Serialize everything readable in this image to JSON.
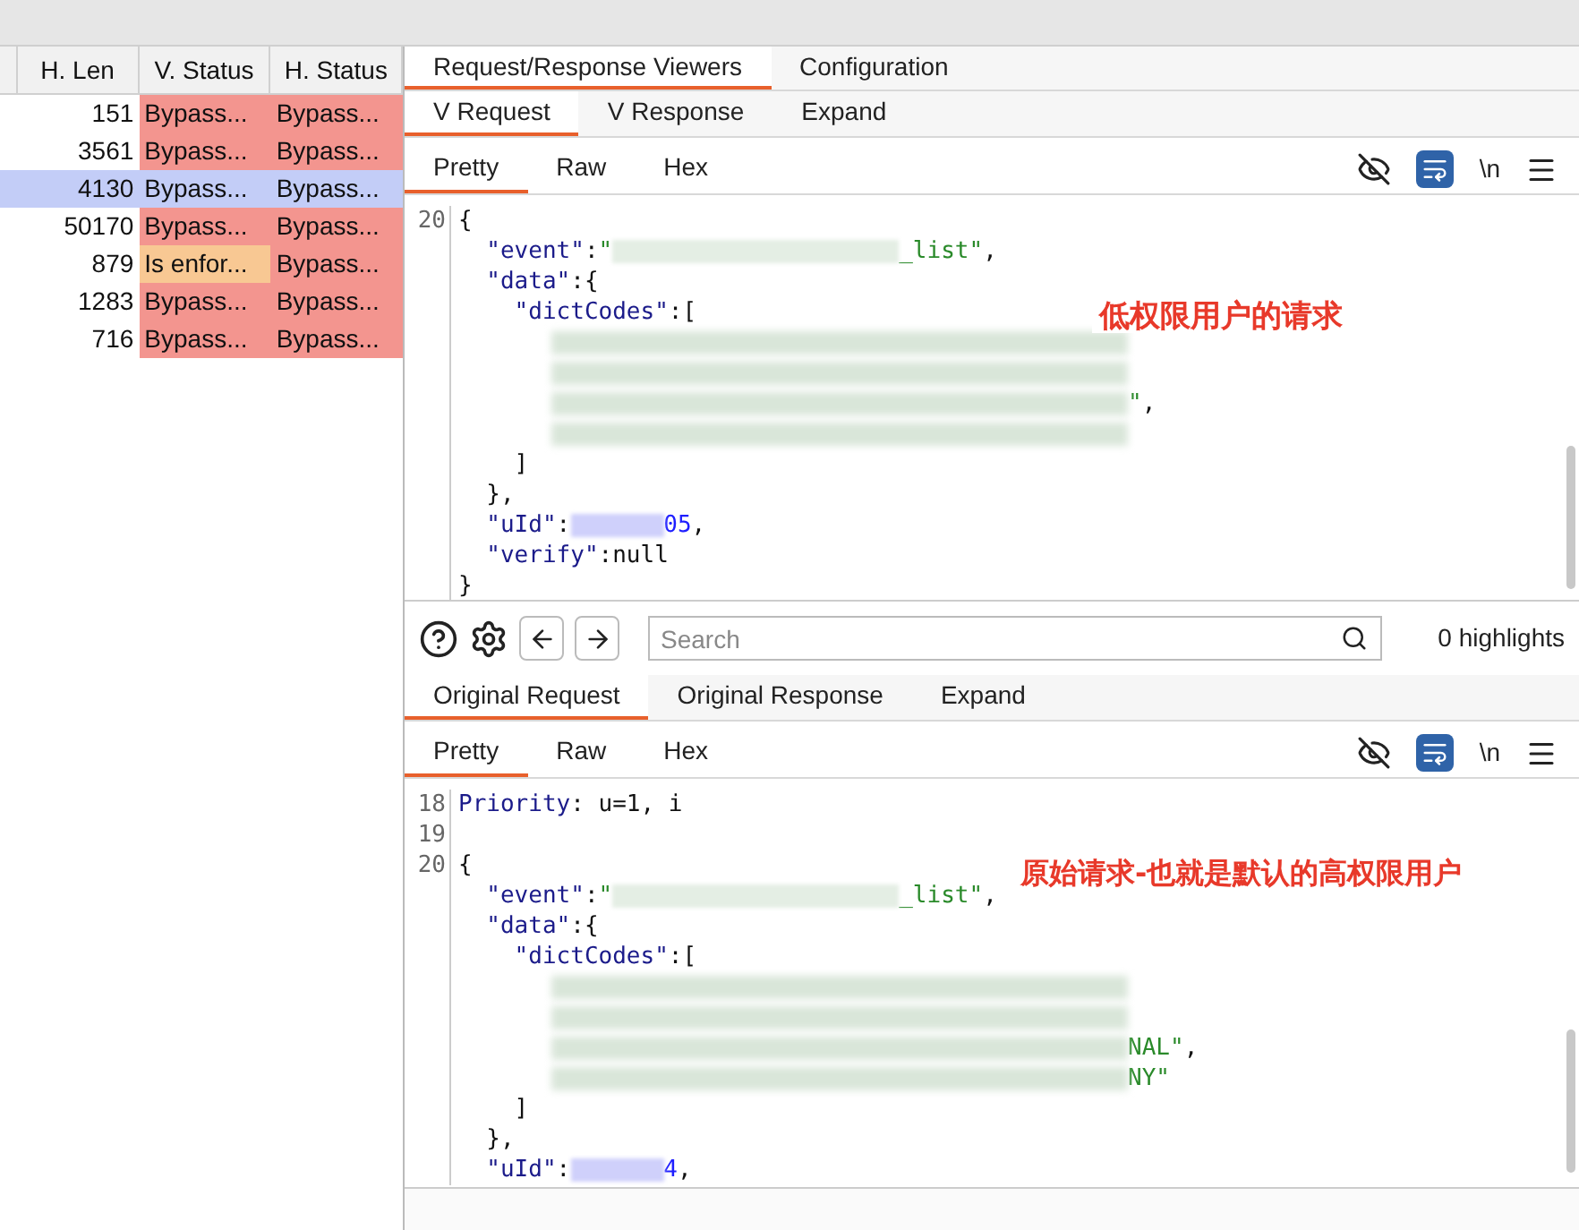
{
  "table": {
    "columns": [
      "H. Len",
      "V. Status",
      "H. Status"
    ],
    "rows": [
      {
        "h_len": "151",
        "v_status": {
          "text": "Bypass...",
          "color": "#f3958f"
        },
        "h_status": {
          "text": "Bypass...",
          "color": "#f3958f"
        },
        "selected": false
      },
      {
        "h_len": "3561",
        "v_status": {
          "text": "Bypass...",
          "color": "#f3958f"
        },
        "h_status": {
          "text": "Bypass...",
          "color": "#f3958f"
        },
        "selected": false
      },
      {
        "h_len": "4130",
        "v_status": {
          "text": "Bypass..."
        },
        "h_status": {
          "text": "Bypass..."
        },
        "selected": true
      },
      {
        "h_len": "50170",
        "v_status": {
          "text": "Bypass...",
          "color": "#f3958f"
        },
        "h_status": {
          "text": "Bypass...",
          "color": "#f3958f"
        },
        "selected": false
      },
      {
        "h_len": "879",
        "v_status": {
          "text": "Is enfor...",
          "color": "#f8c893"
        },
        "h_status": {
          "text": "Bypass...",
          "color": "#f3958f"
        },
        "selected": false
      },
      {
        "h_len": "1283",
        "v_status": {
          "text": "Bypass...",
          "color": "#f3958f"
        },
        "h_status": {
          "text": "Bypass...",
          "color": "#f3958f"
        },
        "selected": false
      },
      {
        "h_len": "716",
        "v_status": {
          "text": "Bypass...",
          "color": "#f3958f"
        },
        "h_status": {
          "text": "Bypass...",
          "color": "#f3958f"
        },
        "selected": false
      }
    ]
  },
  "top_tabs": [
    {
      "label": "Request/Response Viewers",
      "selected": true
    },
    {
      "label": "Configuration",
      "selected": false
    }
  ],
  "editors": [
    {
      "tabs": [
        {
          "label": "V Request",
          "selected": true
        },
        {
          "label": "V Response",
          "selected": false
        },
        {
          "label": "Expand",
          "selected": false
        }
      ],
      "view_tabs": [
        {
          "label": "Pretty",
          "selected": true
        },
        {
          "label": "Raw",
          "selected": false
        },
        {
          "label": "Hex",
          "selected": false
        }
      ],
      "newline_label": "\\n",
      "wrap_on": true,
      "annotation": "低权限用户的请求",
      "lines": [
        {
          "number": "20",
          "tokens": [
            {
              "kind": "punct",
              "text": "{"
            }
          ]
        },
        {
          "tokens": [
            {
              "kind": "key",
              "text": "  \"event\""
            },
            {
              "kind": "punct",
              "text": ":"
            },
            {
              "kind": "str",
              "text": "\""
            },
            {
              "kind": "blur_long"
            },
            {
              "kind": "str",
              "text": "_list\""
            },
            {
              "kind": "punct",
              "text": ","
            }
          ]
        },
        {
          "tokens": [
            {
              "kind": "key",
              "text": "  \"data\""
            },
            {
              "kind": "punct",
              "text": ":{"
            }
          ]
        },
        {
          "tokens": [
            {
              "kind": "key",
              "text": "    \"dictCodes\""
            },
            {
              "kind": "punct",
              "text": ":["
            }
          ]
        },
        {
          "tokens": [
            {
              "kind": "blur_block"
            }
          ]
        },
        {
          "tokens": [
            {
              "kind": "blur_block"
            }
          ]
        },
        {
          "tokens": [
            {
              "kind": "blur_block"
            },
            {
              "kind": "str",
              "text": "\""
            },
            {
              "kind": "punct",
              "text": ","
            }
          ]
        },
        {
          "tokens": [
            {
              "kind": "blur_block"
            }
          ]
        },
        {
          "tokens": [
            {
              "kind": "punct",
              "text": "    ]"
            }
          ]
        },
        {
          "tokens": [
            {
              "kind": "punct",
              "text": "  },"
            }
          ]
        },
        {
          "tokens": [
            {
              "kind": "key",
              "text": "  \"uId\""
            },
            {
              "kind": "punct",
              "text": ":"
            },
            {
              "kind": "blur_short"
            },
            {
              "kind": "num",
              "text": "05"
            },
            {
              "kind": "punct",
              "text": ","
            }
          ]
        },
        {
          "tokens": [
            {
              "kind": "key",
              "text": "  \"verify\""
            },
            {
              "kind": "punct",
              "text": ":null"
            }
          ]
        },
        {
          "tokens": [
            {
              "kind": "punct",
              "text": "}"
            }
          ]
        }
      ]
    },
    {
      "tabs": [
        {
          "label": "Original Request",
          "selected": true
        },
        {
          "label": "Original Response",
          "selected": false
        },
        {
          "label": "Expand",
          "selected": false
        }
      ],
      "view_tabs": [
        {
          "label": "Pretty",
          "selected": true
        },
        {
          "label": "Raw",
          "selected": false
        },
        {
          "label": "Hex",
          "selected": false
        }
      ],
      "newline_label": "\\n",
      "wrap_on": true,
      "annotation": "原始请求-也就是默认的高权限用户",
      "lines": [
        {
          "number": "18",
          "tokens": [
            {
              "kind": "key",
              "text": "Priority"
            },
            {
              "kind": "punct",
              "text": ": u=1, i"
            }
          ]
        },
        {
          "number": "19"
        },
        {
          "number": "20",
          "tokens": [
            {
              "kind": "punct",
              "text": "{"
            }
          ]
        },
        {
          "tokens": [
            {
              "kind": "key",
              "text": "  \"event\""
            },
            {
              "kind": "punct",
              "text": ":"
            },
            {
              "kind": "str",
              "text": "\""
            },
            {
              "kind": "blur_long"
            },
            {
              "kind": "str",
              "text": "_list\""
            },
            {
              "kind": "punct",
              "text": ","
            }
          ]
        },
        {
          "tokens": [
            {
              "kind": "key",
              "text": "  \"data\""
            },
            {
              "kind": "punct",
              "text": ":{"
            }
          ]
        },
        {
          "tokens": [
            {
              "kind": "key",
              "text": "    \"dictCodes\""
            },
            {
              "kind": "punct",
              "text": ":["
            }
          ]
        },
        {
          "tokens": [
            {
              "kind": "blur_block"
            }
          ]
        },
        {
          "tokens": [
            {
              "kind": "blur_block"
            }
          ]
        },
        {
          "tokens": [
            {
              "kind": "blur_block"
            },
            {
              "kind": "str",
              "text": "NAL\""
            },
            {
              "kind": "punct",
              "text": ","
            }
          ]
        },
        {
          "tokens": [
            {
              "kind": "blur_block"
            },
            {
              "kind": "str",
              "text": "NY\""
            }
          ]
        },
        {
          "tokens": [
            {
              "kind": "punct",
              "text": "    ]"
            }
          ]
        },
        {
          "tokens": [
            {
              "kind": "punct",
              "text": "  },"
            }
          ]
        },
        {
          "tokens": [
            {
              "kind": "key",
              "text": "  \"uId\""
            },
            {
              "kind": "punct",
              "text": ":"
            },
            {
              "kind": "blur_short"
            },
            {
              "kind": "num",
              "text": "4"
            },
            {
              "kind": "punct",
              "text": ","
            }
          ]
        }
      ]
    }
  ],
  "search": {
    "placeholder": "Search",
    "highlights": "0 highlights"
  }
}
